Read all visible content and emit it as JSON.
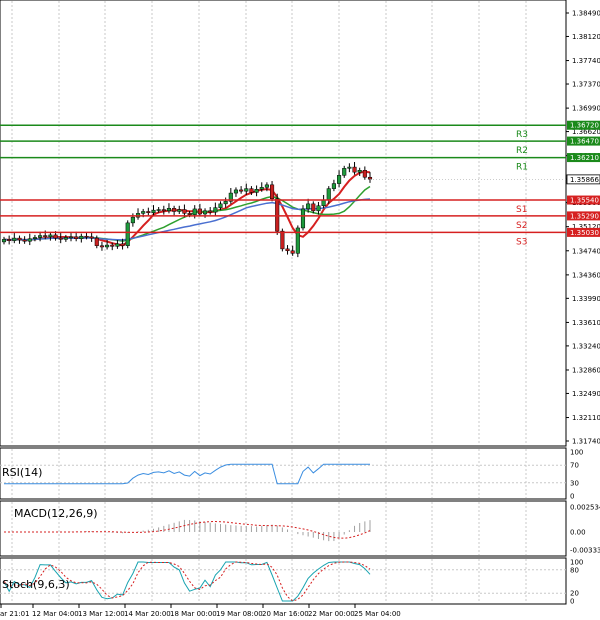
{
  "colors": {
    "grid": "#c8c8c8",
    "resistance": "#1b8a1b",
    "support": "#d62020",
    "bull": "#1e9a3c",
    "bear": "#c82020",
    "ma_fast": "#d62020",
    "ma_mid": "#2fa02f",
    "ma_slow": "#4a6fd0",
    "rsi": "#3a8de0",
    "macd_hist": "#a0a0a0",
    "macd_signal": "#d62020",
    "stoch_main": "#17a3b0",
    "stoch_signal": "#d62020",
    "price_tag": "#000000"
  },
  "price_axis": {
    "ticks": [
      "1.38490",
      "1.38120",
      "1.37740",
      "1.37370",
      "1.36990",
      "1.36620",
      "1.36240",
      "1.35870",
      "1.35500",
      "1.35120",
      "1.34740",
      "1.34360",
      "1.33990",
      "1.33610",
      "1.33240",
      "1.32860",
      "1.32490",
      "1.32110",
      "1.31740"
    ],
    "current": "1.35866"
  },
  "levels": [
    {
      "name": "R3",
      "value": "1.36720",
      "type": "resistance"
    },
    {
      "name": "R2",
      "value": "1.36470",
      "type": "resistance"
    },
    {
      "name": "R1",
      "value": "1.36210",
      "type": "resistance"
    },
    {
      "name": "S1",
      "value": "1.35540",
      "type": "support"
    },
    {
      "name": "S2",
      "value": "1.35290",
      "type": "support"
    },
    {
      "name": "S3",
      "value": "1.35030",
      "type": "support"
    }
  ],
  "time_axis": [
    "ar 21:01",
    "12 Mar 04:00",
    "13 Mar 12:00",
    "14 Mar 20:00",
    "18 Mar 00:00",
    "19 Mar 08:00",
    "20 Mar 16:00",
    "22 Mar 00:00",
    "25 Mar 04:00"
  ],
  "rsi": {
    "label": "RSI(14)",
    "ticks": [
      "100",
      "70",
      "30",
      "0"
    ]
  },
  "macd": {
    "label": "MACD(12,26,9)",
    "ticks": [
      "0.002534",
      "0.00",
      "-0.003339"
    ]
  },
  "stoch": {
    "label": "Stoch(9,6,3)",
    "ticks": [
      "100",
      "80",
      "20",
      "0"
    ]
  }
}
